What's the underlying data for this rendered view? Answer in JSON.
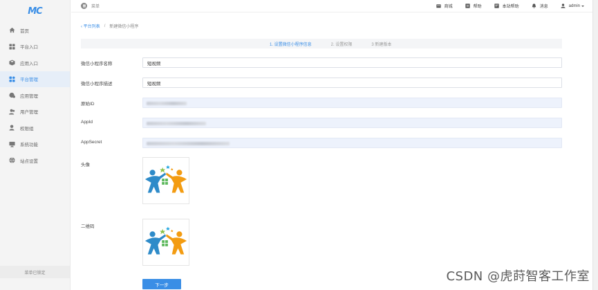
{
  "brand": {
    "logo": "MC"
  },
  "sidebar": {
    "items": [
      {
        "label": "首页",
        "icon": "home-icon",
        "active": false
      },
      {
        "label": "平台入口",
        "icon": "grid-icon",
        "active": false
      },
      {
        "label": "应用入口",
        "icon": "box-icon",
        "active": false
      },
      {
        "label": "平台管理",
        "icon": "apps-icon",
        "active": true
      },
      {
        "label": "应用管理",
        "icon": "app-manage-icon",
        "active": false
      },
      {
        "label": "用户管理",
        "icon": "users-icon",
        "active": false
      },
      {
        "label": "权限组",
        "icon": "permission-icon",
        "active": false
      },
      {
        "label": "系统功能",
        "icon": "monitor-icon",
        "active": false
      },
      {
        "label": "站点设置",
        "icon": "globe-icon",
        "active": false
      }
    ],
    "footer": "菜单已锁定"
  },
  "topbar": {
    "menu_label": "菜单",
    "links": [
      {
        "label": "商城",
        "icon": "store-icon"
      },
      {
        "label": "帮助",
        "icon": "help-icon"
      },
      {
        "label": "本站帮助",
        "icon": "site-help-icon"
      },
      {
        "label": "消息",
        "icon": "bell-icon"
      }
    ],
    "user": "admin"
  },
  "breadcrumb": {
    "back": "平台列表",
    "separator": "/",
    "current": "新建微信小程序"
  },
  "steps": [
    "1. 设置微信小程序信息",
    "2. 设置权限",
    "3 新建版本"
  ],
  "form": {
    "name_label": "微信小程序名称",
    "name_value": "短视频",
    "desc_label": "微信小程序描述",
    "desc_value": "短视频",
    "origin_label": "原始ID",
    "appid_label": "AppId",
    "secret_label": "AppSecret",
    "avatar_label": "头像",
    "qrcode_label": "二维码",
    "next_button": "下一步"
  },
  "watermark": "CSDN @虎莳智客工作室",
  "colors": {
    "accent": "#3a8ee6",
    "sidebar_bg": "#f4f4f4",
    "readonly_bg": "#edf2fc"
  }
}
